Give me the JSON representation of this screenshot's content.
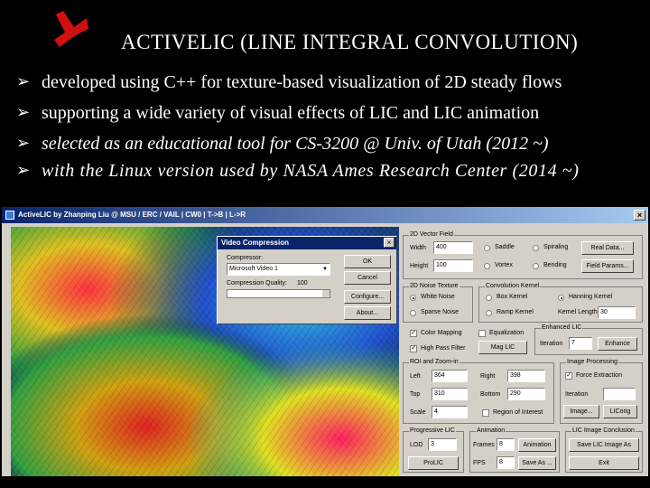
{
  "slide": {
    "title": "ACTIVELIC (LINE INTEGRAL CONVOLUTION)",
    "bullets": [
      "developed using C++ for texture-based visualization of  2D steady flows",
      "supporting  a wide variety of  visual effects of   LIC and  LIC  animation",
      "selected as an educational tool for  CS-3200 @ Univ.  of  Utah (2012 ~)",
      "with  the  Linux version  used  by  NASA Ames Research Center (2014 ~)"
    ],
    "bullet_icon": "arrow-bullet-icon"
  },
  "app": {
    "window_title": "ActiveLIC by Zhanping Liu @ MSU / ERC / VAIL  |  CW0  |  T->B  |  L->R",
    "close_glyph": "×",
    "dialog": {
      "title": "Video Compression",
      "close_glyph": "×",
      "compressor_label": "Compressor:",
      "compressor_value": "Microsoft Video 1",
      "quality_label": "Compression Quality:",
      "quality_value": "100",
      "ok": "OK",
      "cancel": "Cancel",
      "configure": "Configure...",
      "about": "About..."
    },
    "vector_field": {
      "label": "2D Vector Field",
      "width_label": "Width",
      "width_value": "400",
      "height_label": "Height",
      "height_value": "100",
      "opts": [
        "Saddle",
        "Spiraling",
        "Vortex",
        "Bending"
      ],
      "real_data": "Real Data...",
      "field_params": "Field Params..."
    },
    "noise_texture": {
      "label": "2D Noise Texture",
      "white": "White Noise",
      "sparse": "Sparse Noise"
    },
    "convolution": {
      "label": "Convolution Kernel",
      "box": "Box Kernel",
      "ramp": "Ramp Kernel",
      "hanning": "Hanning Kernel",
      "length_label": "Kernel Length",
      "length_value": "30"
    },
    "color_mapping": "Color Mapping",
    "equalization": "Equalization",
    "high_pass": "High Pass Filter",
    "mag_lic": "Mag LIC",
    "enhanced_lic": {
      "label": "Enhanced LIC",
      "iteration_label": "Iteration",
      "iteration_value": "7",
      "enhance": "Enhance"
    },
    "roi": {
      "label": "ROI and Zoom-in",
      "left_label": "Left",
      "left_value": "364",
      "right_label": "Right",
      "right_value": "398",
      "top_label": "Top",
      "top_value": "310",
      "bottom_label": "Bottom",
      "bottom_value": "290",
      "scale_label": "Scale",
      "scale_value": "4",
      "region_label": "Region of Interest"
    },
    "image_processing": {
      "label": "Image Processing",
      "force_extraction": "Force Extraction",
      "iteration_label": "Iteration",
      "iteration_value": "",
      "image": "Image...",
      "lic_orig": "LICorig"
    },
    "progressive": {
      "label": "Progressive LIC",
      "lod_label": "LOD",
      "lod_value": "3",
      "button": "ProLIC"
    },
    "animation": {
      "label": "Animation",
      "frames_label": "Frames",
      "frames_value": "8",
      "fps_label": "FPS",
      "fps_value": "8",
      "animation": "Animation",
      "save_as": "Save As ..."
    },
    "lic_image": {
      "label": "LIC Image Conclusion",
      "save": "Save LIC Image As",
      "exit": "Exit"
    }
  },
  "colors": {
    "background": "#000000",
    "logo_red": "#d01010",
    "window_gray": "#d4d0c8",
    "title_blue": "#0a246a"
  }
}
